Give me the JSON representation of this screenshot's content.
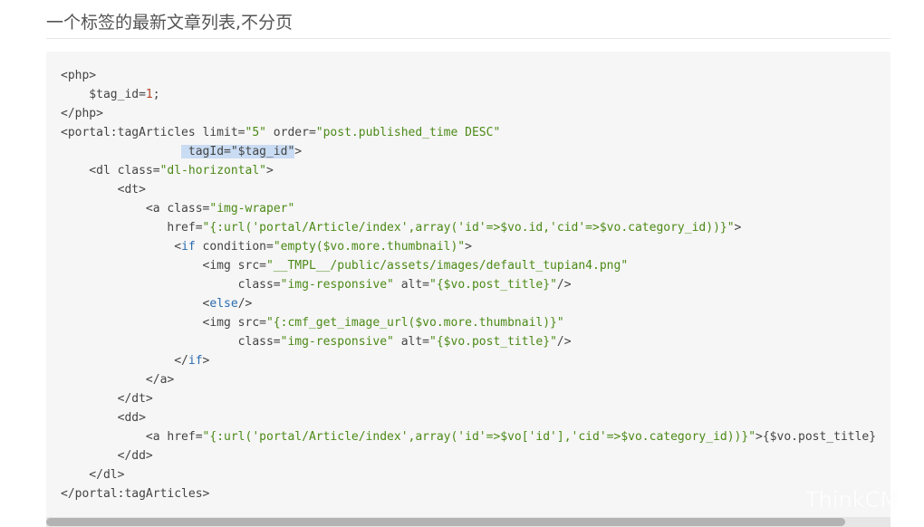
{
  "section": {
    "title": "一个标签的最新文章列表,不分页"
  },
  "watermark": {
    "text": "ThinkCM"
  },
  "scrollbar": {
    "position_fraction": 0.0,
    "visible_fraction": 0.946
  },
  "code": {
    "lines": [
      [
        {
          "t": "<php>",
          "c": "tag"
        }
      ],
      [
        {
          "t": "    $tag_id=",
          "c": "tag"
        },
        {
          "t": "1",
          "c": "num"
        },
        {
          "t": ";",
          "c": "tag"
        }
      ],
      [
        {
          "t": "</php>",
          "c": "tag"
        }
      ],
      [
        {
          "t": "<portal:tagArticles limit=",
          "c": "tag"
        },
        {
          "t": "\"5\"",
          "c": "str"
        },
        {
          "t": " order=",
          "c": "tag"
        },
        {
          "t": "\"post.published_time DESC\"",
          "c": "str"
        }
      ],
      [
        {
          "t": "                 ",
          "c": "tag"
        },
        {
          "t": " tagId=\"$tag_id\"",
          "c": "hl"
        },
        {
          "t": ">",
          "c": "tag"
        }
      ],
      [
        {
          "t": "    <dl class=",
          "c": "tag"
        },
        {
          "t": "\"dl-horizontal\"",
          "c": "str"
        },
        {
          "t": ">",
          "c": "tag"
        }
      ],
      [
        {
          "t": "        <dt>",
          "c": "tag"
        }
      ],
      [
        {
          "t": "            <a class=",
          "c": "tag"
        },
        {
          "t": "\"img-wraper\"",
          "c": "str"
        }
      ],
      [
        {
          "t": "               href=",
          "c": "tag"
        },
        {
          "t": "\"{:url('portal/Article/index',array('id'=>$vo.id,'cid'=>$vo.category_id))}\"",
          "c": "str"
        },
        {
          "t": ">",
          "c": "tag"
        }
      ],
      [
        {
          "t": "                <",
          "c": "tag"
        },
        {
          "t": "if",
          "c": "kw"
        },
        {
          "t": " condition=",
          "c": "tag"
        },
        {
          "t": "\"empty($vo.more.thumbnail)\"",
          "c": "str"
        },
        {
          "t": ">",
          "c": "tag"
        }
      ],
      [
        {
          "t": "                    <img src=",
          "c": "tag"
        },
        {
          "t": "\"__TMPL__/public/assets/images/default_tupian4.png\"",
          "c": "str"
        }
      ],
      [
        {
          "t": "                         class=",
          "c": "tag"
        },
        {
          "t": "\"img-responsive\"",
          "c": "str"
        },
        {
          "t": " alt=",
          "c": "tag"
        },
        {
          "t": "\"{$vo.post_title}\"",
          "c": "str"
        },
        {
          "t": "/>",
          "c": "tag"
        }
      ],
      [
        {
          "t": "                    <",
          "c": "tag"
        },
        {
          "t": "else",
          "c": "kw"
        },
        {
          "t": "/>",
          "c": "tag"
        }
      ],
      [
        {
          "t": "                    <img src=",
          "c": "tag"
        },
        {
          "t": "\"{:cmf_get_image_url($vo.more.thumbnail)}\"",
          "c": "str"
        }
      ],
      [
        {
          "t": "                         class=",
          "c": "tag"
        },
        {
          "t": "\"img-responsive\"",
          "c": "str"
        },
        {
          "t": " alt=",
          "c": "tag"
        },
        {
          "t": "\"{$vo.post_title}\"",
          "c": "str"
        },
        {
          "t": "/>",
          "c": "tag"
        }
      ],
      [
        {
          "t": "                </",
          "c": "tag"
        },
        {
          "t": "if",
          "c": "kw"
        },
        {
          "t": ">",
          "c": "tag"
        }
      ],
      [
        {
          "t": "            </a>",
          "c": "tag"
        }
      ],
      [
        {
          "t": "        </dt>",
          "c": "tag"
        }
      ],
      [
        {
          "t": "        <dd>",
          "c": "tag"
        }
      ],
      [
        {
          "t": "            <a href=",
          "c": "tag"
        },
        {
          "t": "\"{:url('portal/Article/index',array('id'=>$vo['id'],'cid'=>$vo.category_id))}\"",
          "c": "str"
        },
        {
          "t": ">{$vo.post_title}",
          "c": "tag"
        }
      ],
      [
        {
          "t": "        </dd>",
          "c": "tag"
        }
      ],
      [
        {
          "t": "    </dl>",
          "c": "tag"
        }
      ],
      [
        {
          "t": "</portal:tagArticles>",
          "c": "tag"
        }
      ]
    ]
  }
}
